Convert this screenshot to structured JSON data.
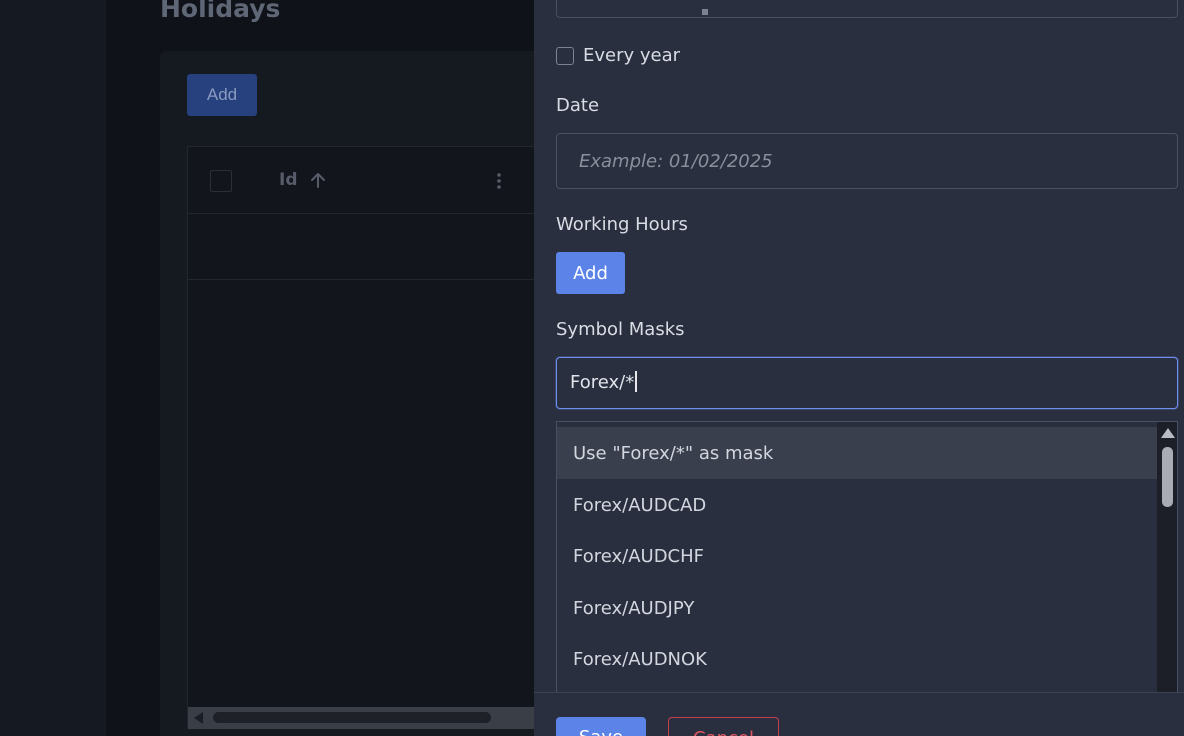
{
  "background": {
    "page_title": "Holidays",
    "add_button_label": "Add",
    "grid": {
      "columns": [
        {
          "label": "Id",
          "sort": "ascending"
        }
      ]
    }
  },
  "drawer": {
    "every_year": {
      "label": "Every year",
      "checked": false
    },
    "date": {
      "label": "Date",
      "placeholder": "Example: 01/02/2025",
      "value": ""
    },
    "working_hours": {
      "label": "Working Hours",
      "add_button_label": "Add"
    },
    "symbol_masks": {
      "label": "Symbol Masks",
      "input_value": "Forex/*",
      "options": [
        "Use \"Forex/*\" as mask",
        "Forex/AUDCAD",
        "Forex/AUDCHF",
        "Forex/AUDJPY",
        "Forex/AUDNOK"
      ]
    },
    "footer": {
      "save_label": "Save",
      "cancel_label": "Cancel"
    }
  },
  "colors": {
    "accent": "#5b83e8",
    "focus_border": "#6d90f0",
    "danger": "#e05563",
    "drawer_bg": "#2a2f3f"
  }
}
